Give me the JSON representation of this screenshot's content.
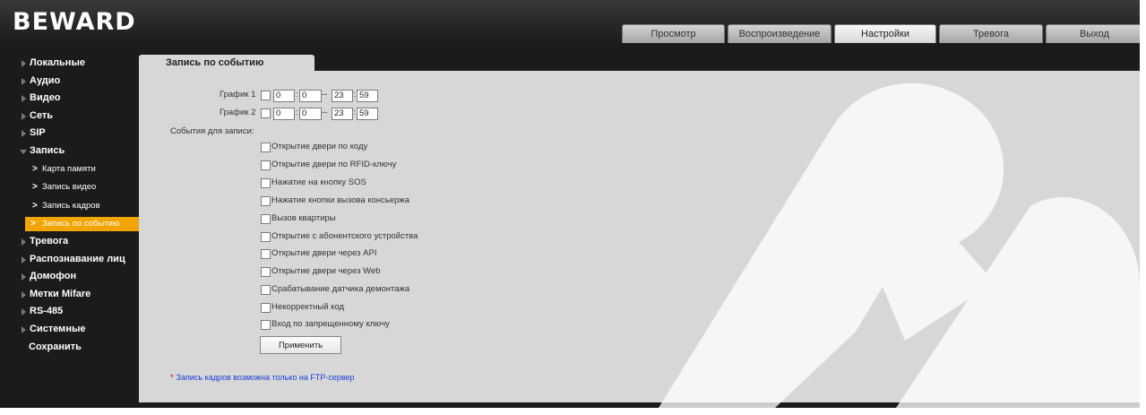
{
  "logo": "BEWARD",
  "tabs": [
    "Просмотр",
    "Воспроизведение",
    "Настройки",
    "Тревога",
    "Выход"
  ],
  "active_tab": "Настройки",
  "sidebar": {
    "items": [
      {
        "label": "Локальные"
      },
      {
        "label": "Аудио"
      },
      {
        "label": "Видео"
      },
      {
        "label": "Сеть"
      },
      {
        "label": "SIP"
      },
      {
        "label": "Запись"
      },
      {
        "label": "Карта памяти"
      },
      {
        "label": "Запись видео"
      },
      {
        "label": "Запись кадров"
      },
      {
        "label": "Запись по событию"
      },
      {
        "label": "Тревога"
      },
      {
        "label": "Распознавание лиц"
      },
      {
        "label": "Домофон"
      },
      {
        "label": "Метки Mifare"
      },
      {
        "label": "RS-485"
      },
      {
        "label": "Системные"
      },
      {
        "label": "Сохранить"
      }
    ],
    "active_item": "Запись по событию"
  },
  "page": {
    "tab_title": "Запись по событию",
    "schedule1": {
      "label": "График 1",
      "start_h": "0",
      "start_m": "0",
      "end_h": "23",
      "end_m": "59"
    },
    "schedule2": {
      "label": "График 2",
      "start_h": "0",
      "start_m": "0",
      "end_h": "23",
      "end_m": "59"
    },
    "events_title": "События для записи:",
    "events": [
      "Открытие двери по коду",
      "Открытие двери по RFID-ключу",
      "Нажатие на кнопку SOS",
      "Нажатие кнопки вызова консьержа",
      "Вызов квартиры",
      "Открытие с абонентского устройства",
      "Открытие двери через API",
      "Открытие двери через Web",
      "Срабатывание датчика демонтажа",
      "Некорректный код",
      "Вход по запрещенному ключу"
    ],
    "apply_label": "Применить",
    "note_star": "*",
    "note": "Запись кадров возможна только на FTP-сервер"
  },
  "colors": {
    "accent": "#f0a500",
    "panel": "#d7d7d7",
    "background": "#1b1b1b",
    "note_text": "#1a3ed8",
    "note_star": "#e00000"
  }
}
